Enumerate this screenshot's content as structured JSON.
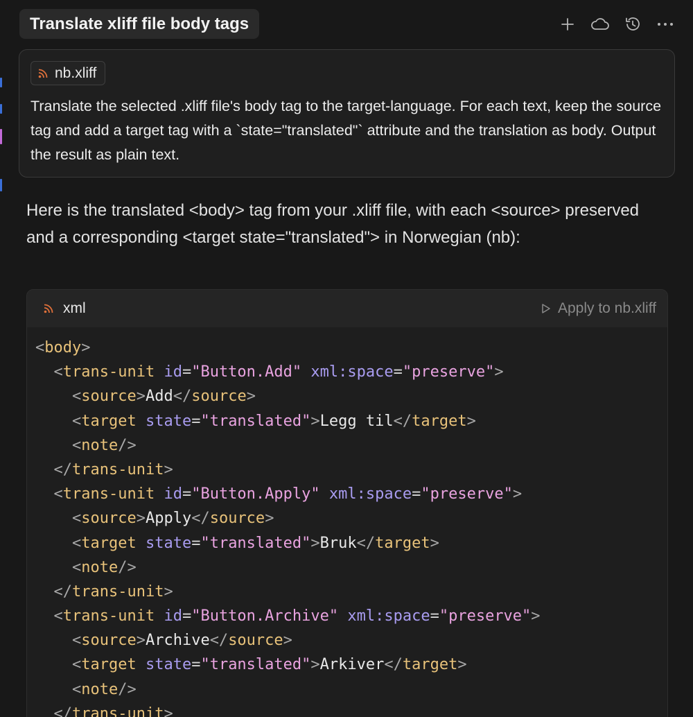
{
  "header": {
    "title": "Translate xliff file body tags",
    "actions": [
      {
        "name": "new-chat",
        "icon": "plus-icon"
      },
      {
        "name": "cloud",
        "icon": "cloud-icon"
      },
      {
        "name": "history",
        "icon": "history-icon"
      },
      {
        "name": "more",
        "icon": "ellipsis-icon"
      }
    ]
  },
  "prompt": {
    "file_chip": {
      "label": "nb.xliff",
      "icon": "rss-icon"
    },
    "text": "Translate the selected .xliff file's body tag to the target-language. For each text, keep the source tag and add a target tag with a `state=\"translated\"` attribute and the translation as body. Output the result as plain text."
  },
  "reply": {
    "text": "Here is the translated <body> tag from your .xliff file, with each <source> preserved and a corresponding <target state=\"translated\"> in Norwegian (nb):"
  },
  "code_block": {
    "language": "xml",
    "language_icon": "rss-icon",
    "apply_label": "Apply to nb.xliff",
    "apply_icon": "play-icon",
    "lines": [
      "<body>",
      "  <trans-unit id=\"Button.Add\" xml:space=\"preserve\">",
      "    <source>Add</source>",
      "    <target state=\"translated\">Legg til</target>",
      "    <note/>",
      "  </trans-unit>",
      "  <trans-unit id=\"Button.Apply\" xml:space=\"preserve\">",
      "    <source>Apply</source>",
      "    <target state=\"translated\">Bruk</target>",
      "    <note/>",
      "  </trans-unit>",
      "  <trans-unit id=\"Button.Archive\" xml:space=\"preserve\">",
      "    <source>Archive</source>",
      "    <target state=\"translated\">Arkiver</target>",
      "    <note/>",
      "  </trans-unit>"
    ]
  },
  "colors": {
    "background": "#181818",
    "tag": "#e8c27a",
    "attribute": "#a99cf0",
    "string": "#e9a3e0",
    "rss_icon": "#e0703a"
  }
}
